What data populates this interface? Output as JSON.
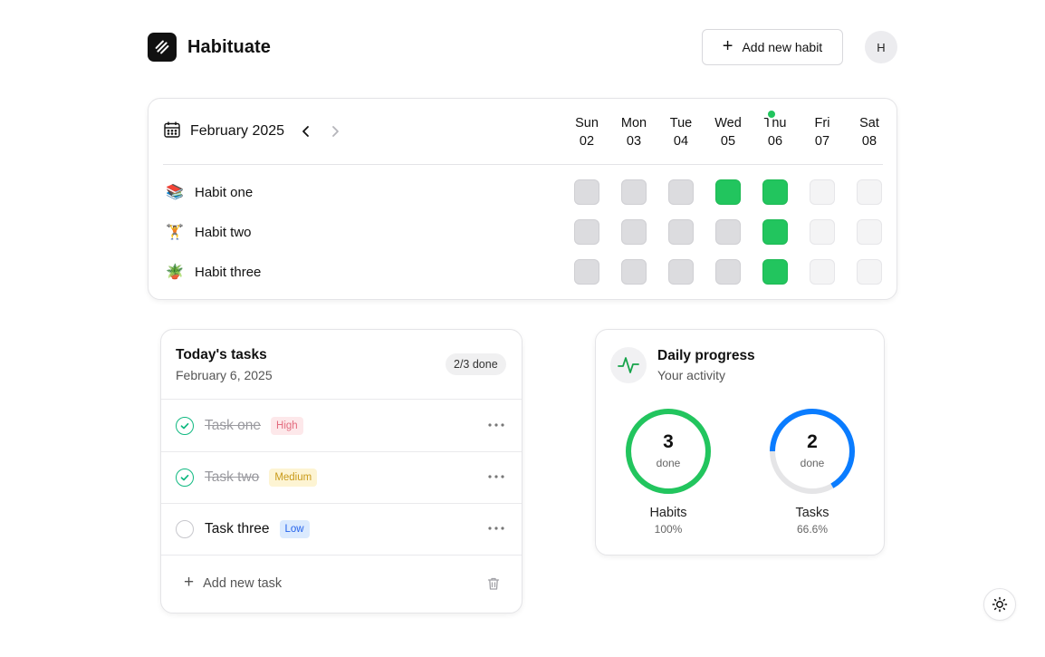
{
  "header": {
    "app_name": "Habituate",
    "add_habit_label": "Add new habit",
    "avatar_initial": "H"
  },
  "tracker": {
    "month_label": "February 2025",
    "today_index": 4,
    "days": [
      {
        "weekday": "Sun",
        "date": "02"
      },
      {
        "weekday": "Mon",
        "date": "03"
      },
      {
        "weekday": "Tue",
        "date": "04"
      },
      {
        "weekday": "Wed",
        "date": "05"
      },
      {
        "weekday": "Thu",
        "date": "06"
      },
      {
        "weekday": "Fri",
        "date": "07"
      },
      {
        "weekday": "Sat",
        "date": "08"
      }
    ],
    "habits": [
      {
        "emoji": "📚",
        "name": "Habit one",
        "status": [
          "missed",
          "missed",
          "missed",
          "done",
          "done",
          "future",
          "future"
        ]
      },
      {
        "emoji": "🏋️",
        "name": "Habit two",
        "status": [
          "missed",
          "missed",
          "missed",
          "missed",
          "done",
          "future",
          "future"
        ]
      },
      {
        "emoji": "🪴",
        "name": "Habit three",
        "status": [
          "missed",
          "missed",
          "missed",
          "missed",
          "done",
          "future",
          "future"
        ]
      }
    ]
  },
  "tasks": {
    "title": "Today's tasks",
    "date": "February 6, 2025",
    "done_badge": "2/3 done",
    "items": [
      {
        "name": "Task one",
        "priority": "High",
        "priority_level": "high",
        "completed": true
      },
      {
        "name": "Task two",
        "priority": "Medium",
        "priority_level": "medium",
        "completed": true
      },
      {
        "name": "Task three",
        "priority": "Low",
        "priority_level": "low",
        "completed": false
      }
    ],
    "add_label": "Add new task"
  },
  "progress": {
    "title": "Daily progress",
    "subtitle": "Your activity",
    "rings": [
      {
        "value": "3",
        "unit": "done",
        "label": "Habits",
        "percent": "100%",
        "fraction": 1.0,
        "color": "#22c55e"
      },
      {
        "value": "2",
        "unit": "done",
        "label": "Tasks",
        "percent": "66.6%",
        "fraction": 0.666,
        "color": "#0a7cff"
      }
    ]
  },
  "colors": {
    "done": "#22c55e",
    "accent_blue": "#0a7cff",
    "check_green": "#10b981"
  },
  "icons": {
    "logo": "link-logo-icon",
    "add": "plus-icon",
    "calendar": "calendar-icon",
    "prev": "chevron-left-icon",
    "next": "chevron-right-icon",
    "more": "more-horizontal-icon",
    "delete": "trash-icon",
    "activity": "activity-pulse-icon",
    "theme": "sun-icon"
  }
}
